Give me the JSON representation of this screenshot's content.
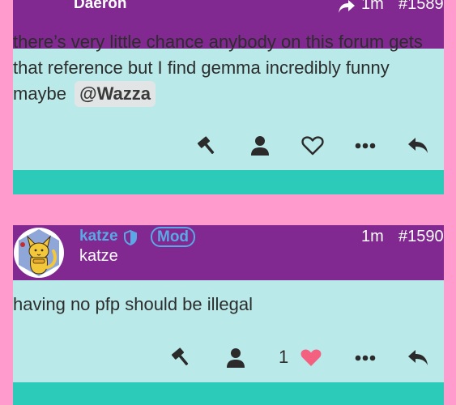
{
  "posts": [
    {
      "username": "Daeron",
      "reply_time": "1m",
      "post_number": "#1589",
      "body_lines": [
        "there’s very little chance anybody on this forum gets",
        "that reference but I find gemma incredibly funny",
        "maybe "
      ],
      "mention": "@Wazza",
      "actions": [
        "flag-icon",
        "user-icon",
        "heart-icon",
        "more-icon",
        "reply-icon"
      ]
    },
    {
      "username": "katze",
      "badge": "Mod",
      "display_name": "katze",
      "time": "1m",
      "post_number": "#1590",
      "body": "having no pfp should be illegal",
      "like_count": "1",
      "actions": [
        "flag-icon",
        "user-icon",
        "heart-filled-icon",
        "more-icon",
        "reply-icon"
      ]
    }
  ],
  "colors": {
    "page_bg": "#ff9ccd",
    "header_bg": "#812990",
    "body_bg": "#b9e9e8",
    "footer_bg": "#2ccab9",
    "username_blue": "#5aa9e6",
    "heart_filled": "#f4607f"
  }
}
